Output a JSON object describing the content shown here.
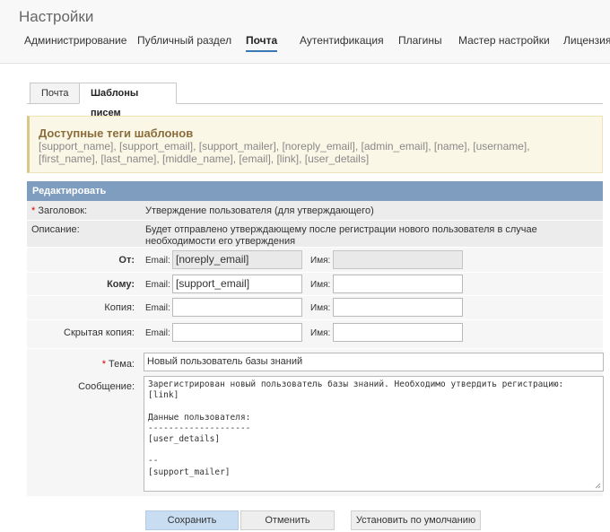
{
  "page": {
    "title": "Настройки"
  },
  "nav": {
    "items": [
      {
        "label": "Администрирование"
      },
      {
        "label": "Публичный раздел"
      },
      {
        "label": "Почта"
      },
      {
        "label": "Аутентификация"
      },
      {
        "label": "Плагины"
      },
      {
        "label": "Мастер настройки"
      },
      {
        "label": "Лицензия"
      }
    ],
    "active": "Почта"
  },
  "subtabs": {
    "items": [
      {
        "label": "Почта"
      },
      {
        "label": "Шаблоны писем"
      }
    ],
    "active": "Шаблоны писем"
  },
  "tags": {
    "title": "Доступные теги шаблонов",
    "list": "[support_name], [support_email], [support_mailer], [noreply_email], [admin_email], [name], [username], [first_name], [last_name], [middle_name], [email], [link], [user_details]"
  },
  "form": {
    "header": "Редактировать",
    "heading_label": "Заголовок:",
    "heading_value": "Утверждение пользователя (для утверждающего)",
    "description_label": "Описание:",
    "description_value": "Будет отправлено утверждающему после регистрации нового пользователя в случае необходимости его утверждения",
    "email_label": "Email:",
    "name_label": "Имя:",
    "from": {
      "label": "От:",
      "email": "[noreply_email]",
      "name": ""
    },
    "to": {
      "label": "Кому:",
      "email": "[support_email]",
      "name": ""
    },
    "cc": {
      "label": "Копия:",
      "email": "",
      "name": ""
    },
    "bcc": {
      "label": "Скрытая копия:",
      "email": "",
      "name": ""
    },
    "subject_label": "Тема:",
    "subject_value": "Новый пользователь базы знаний",
    "message_label": "Сообщение:",
    "message_value": "Зарегистрирован новый пользователь базы знаний. Необходимо утвердить регистрацию:\n[link]\n\nДанные пользователя:\n--------------------\n[user_details]\n\n--\n[support_mailer]"
  },
  "buttons": {
    "save": "Сохранить",
    "cancel": "Отменить",
    "reset": "Установить по умолчанию"
  },
  "colors": {
    "header_bar": "#7f9dbf",
    "primary_button": "#c8ddf2",
    "tags_background": "#fbf7e6",
    "required": "#cc0000"
  }
}
